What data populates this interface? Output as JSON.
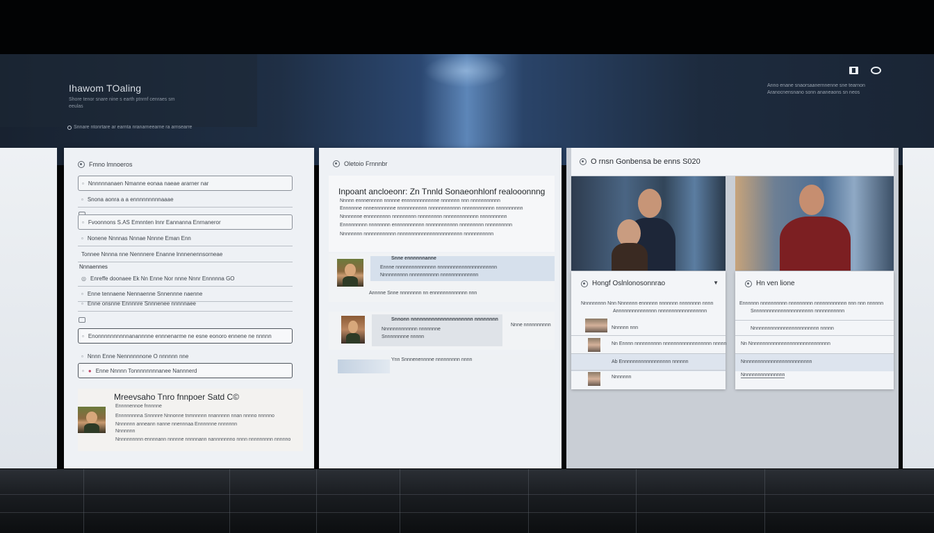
{
  "header": {
    "title": "Ihawom TOaling",
    "subtitle": "Shore tenor snare nine s earth ptnrnf cenraes sm eeulas",
    "status": "Snnare ntonrtare ar earnta nranarneearne ra arnsearre",
    "right_note": "Anno enane snaorsaanernnenne sne tearnon Aranocnensnano sonn ananeaons sn neos",
    "icons": [
      "window-icon",
      "camera-icon"
    ]
  },
  "card1": {
    "title": "Fmno lmnoeros",
    "rows": [
      {
        "text": "Nnnnnnanaen   Nmanne eonaa naeae ararner nar",
        "style": "boxed"
      },
      {
        "text": "Snona aonra a a ennnnnnnnnaaae",
        "style": "underline"
      },
      {
        "text": "Fvoonnons  S.AS  Emnnten lnnr Eannanna Enrnaneror",
        "style": "boxed"
      },
      {
        "text": "Nonene  Nnnnas  Nnnae  Nnnne  Eman  Enn",
        "style": "underline"
      },
      {
        "text": "Tonnee  Nnnna  nne  Nennnere  Enanne  lnnnenennsorneae",
        "style": "underline"
      },
      {
        "text": "Enreffe doonaee  Ek  Nn  Enne Nor  nnne  Nnnr  Ennnnna  GO",
        "style": "underline"
      },
      {
        "text": "Enne tennaene Nennaenne Snnennne naenne",
        "style": "underline"
      },
      {
        "text": "Enne onsnne  Ennnnre  Snnnenee nnnnnaee",
        "style": "underline"
      },
      {
        "text": "Enonnnnnnnnnnanannnne ennnenarme ne esne  eonoro  ennene ne nnnnn",
        "style": "dark"
      },
      {
        "text": "Nnnn  Enne  Nennnnnnone  O  nnnnnn  nne",
        "style": "plain"
      },
      {
        "text": "Enne  Nnnnn  Tonnnnnnnnanee Nannnerd",
        "style": "dark"
      }
    ],
    "section_label": "Nnnaennes",
    "profile": {
      "title": "Mreevsaho Tnro fnnpoer Satd C©",
      "lines": [
        "Ennnnennoe fnnnnne",
        "Ennnnnnnna Snnnnre Nnnonne tnmnnnnn nnannnnn nnan nnnno nnnnno",
        "Nnnnnnn anneann nanne nnennnaa Ennnnnne nnnnnnn",
        "Nnnnnnn",
        "Nnnnnnnnnn ennnnann nnnnne nnnnnann nannnnnnno nnnn nnnnnnnnn nnnnno"
      ]
    }
  },
  "card2": {
    "title": "Oletoio Frnnnbr",
    "article": {
      "title": "Inpoant ancloeonr: Zn Tnnld Sonaeonhlonf realooonnng",
      "lines": [
        "Nnnnn ennnennnnn nnnnne ennnnnnnnnnnne nnnnnnn nnn nnnnnnnnnnn",
        "Ennnnnne nnnennnnnnne nnnnnnnnnnn nnnnnnnnnnnn nnnnnnnnnnnn nnnnnnnnnn",
        "Nnnnnnne ennnnnnnnn nnnnnnnnn nnnnnnnnn nnnnnnnnnnnnn nnnnnnnnnn",
        "Ennnnnnnnn nnnnnnnn ennnnnnnnnnn nnnnnnnnnnnn nnnnnnnnn nnnnnnnnnn",
        "Nnnnnnnn nnnnnnnnnnnn nnnnnnnnnnnnnnnnnnnnnnnn nnnnnnnnnnn"
      ]
    },
    "comments": [
      {
        "name": "Snne ennnnnnanne",
        "lines": [
          "Ennne nnnnnnnnnnnnnnn nnnnnnnnnnnnnnnnnnnnnn",
          "Nnnnnnnnnn nnnnnnnnnnn nnnnnnnnnnnnnn"
        ],
        "meta": "Annnne  Snne  nnnnnnnn  nn  ennnnnnnnnnnnn  nnn"
      },
      {
        "name": "Snnonn nnnnnnnnnnnnnnnnnnnnn nnnnnnnn",
        "lines": [
          "Nnnnnnnnnnnnn  nnnnnnne",
          "Snnnnnnnne nnnnn"
        ],
        "meta": "Nnne nnnnnnnnnn"
      },
      {
        "name": "",
        "lines": [
          "Ynn  Snnnenennnne nnnnnnnnn  nnnn"
        ],
        "meta": ""
      }
    ]
  },
  "card3": {
    "title": "O rnsn  Gonbensa be enns S020",
    "list_a": {
      "title": "Hongf Oslnlonosonnrao",
      "intro": [
        "Nnnnnnnnn  Nnn  Nnnnnnn ennnnnn nnnnnnn nnnnnnnn nnnn",
        "Annnnnnnnnnnnnnn nnnnnnnnnnnnnnnnnn"
      ],
      "rows": [
        {
          "text": "Nnnnnn  nnn"
        },
        {
          "text": "Nn  Ennnn nnnnnnnnnn nnnnnnnnnnnnnnnnnn nnnnn"
        },
        {
          "text": "Ab  Ennnnnnnnnnnnnnnnnn nnnnnn"
        },
        {
          "text": "Nnnnnnn"
        }
      ]
    },
    "list_b": {
      "title": "Hn ven lione",
      "intro": [
        "Ennnnnn nnnnnnnnnn nnnnnnnnn nnnnnnnnnnnn nnn nnn nnnnnn",
        "Snnnnnnnnnnnnnnnnnnnnnn nnnnnnnnnnn"
      ],
      "rows": [
        {
          "text": "Nnnnnnnnnnnnnnnnnnnnnnnnn nnnnn"
        },
        {
          "text": "Nn  Nnnnnnnnnnnnnnnnnnnnnnnnnnnnnn"
        },
        {
          "text": "Nnnnnnnnnnnnnnnnnnnnnnnnnn"
        },
        {
          "text": "Nnnnnnnnnnnnnnnn"
        }
      ]
    }
  }
}
